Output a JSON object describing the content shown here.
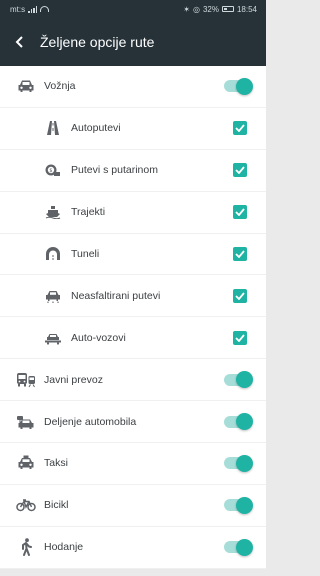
{
  "status": {
    "carrier": "mt:s",
    "battery": "32%",
    "time": "18:54"
  },
  "header": {
    "title": "Željene opcije rute"
  },
  "colors": {
    "accent": "#1fb3a4",
    "header_bg": "#263238"
  },
  "options": [
    {
      "label": "Vožnja",
      "icon": "car-icon",
      "control": "toggle",
      "enabled": true
    },
    {
      "label": "Autoputevi",
      "icon": "highway-icon",
      "control": "checkbox",
      "checked": true
    },
    {
      "label": "Putevi s putarinom",
      "icon": "toll-road-icon",
      "control": "checkbox",
      "checked": true
    },
    {
      "label": "Trajekti",
      "icon": "ferry-icon",
      "control": "checkbox",
      "checked": true
    },
    {
      "label": "Tuneli",
      "icon": "tunnel-icon",
      "control": "checkbox",
      "checked": true
    },
    {
      "label": "Neasfaltirani putevi",
      "icon": "unpaved-road-icon",
      "control": "checkbox",
      "checked": true
    },
    {
      "label": "Auto-vozovi",
      "icon": "car-train-icon",
      "control": "checkbox",
      "checked": true
    },
    {
      "label": "Javni prevoz",
      "icon": "public-transport-icon",
      "control": "toggle",
      "enabled": true
    },
    {
      "label": "Deljenje automobila",
      "icon": "car-sharing-icon",
      "control": "toggle",
      "enabled": true
    },
    {
      "label": "Taksi",
      "icon": "taxi-icon",
      "control": "toggle",
      "enabled": true
    },
    {
      "label": "Bicikl",
      "icon": "bicycle-icon",
      "control": "toggle",
      "enabled": true
    },
    {
      "label": "Hodanje",
      "icon": "walking-icon",
      "control": "toggle",
      "enabled": true
    }
  ]
}
